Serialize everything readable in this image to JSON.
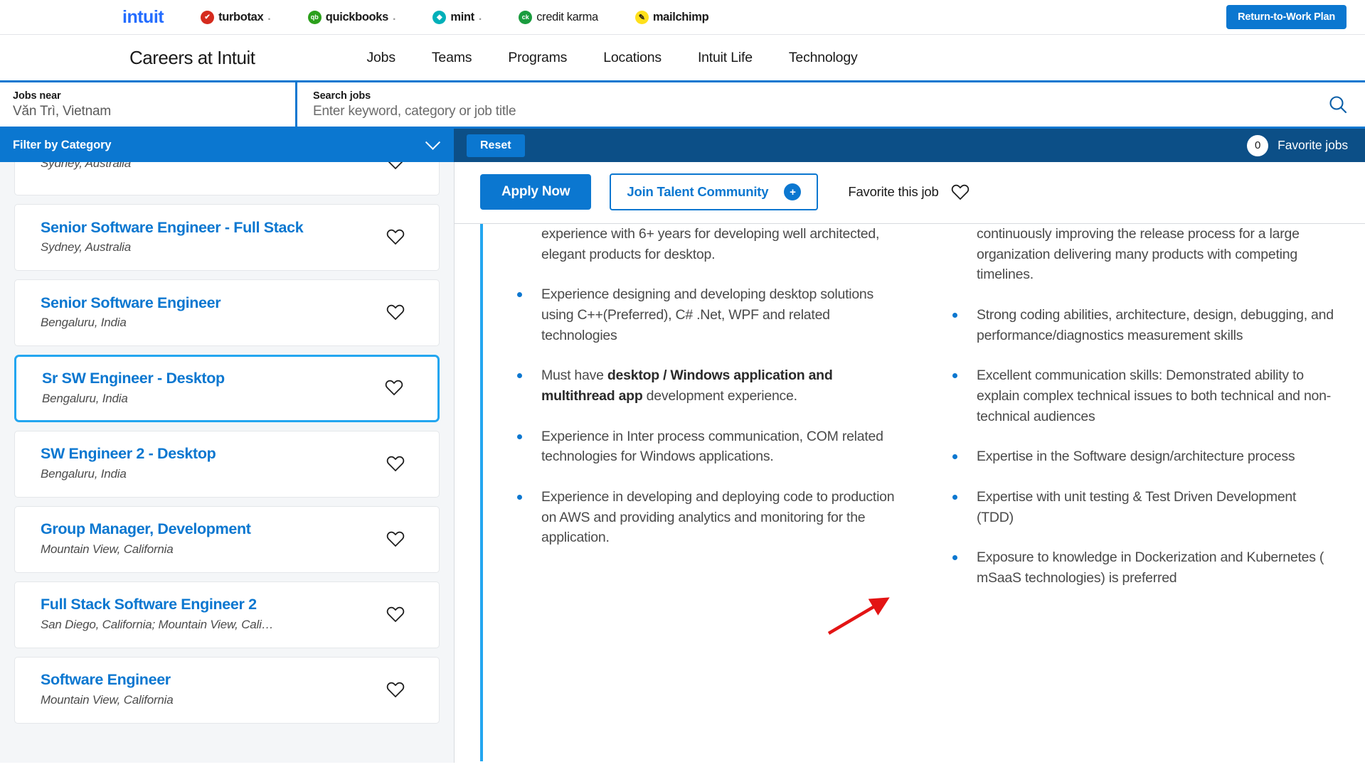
{
  "brandbar": {
    "logos": [
      {
        "name": "intuit",
        "label": "intuit",
        "type": "wordmark"
      },
      {
        "name": "turbotax",
        "label": "turbotax",
        "mark": "✔",
        "color": "#d52b1e"
      },
      {
        "name": "quickbooks",
        "label": "quickbooks",
        "mark": "qb",
        "color": "#2ca01c"
      },
      {
        "name": "mint",
        "label": "mint",
        "mark": "◆",
        "color": "#00b0b9"
      },
      {
        "name": "credit karma",
        "label": "credit karma",
        "mark": "ck",
        "color": "#1a9c3e"
      },
      {
        "name": "mailchimp",
        "label": "mailchimp",
        "mark": "✎",
        "color": "#ffe01b"
      }
    ],
    "cta_label": "Return-to-Work Plan"
  },
  "mainnav": {
    "site_title": "Careers at Intuit",
    "links": [
      {
        "label": "Jobs"
      },
      {
        "label": "Teams"
      },
      {
        "label": "Programs"
      },
      {
        "label": "Locations"
      },
      {
        "label": "Intuit Life"
      },
      {
        "label": "Technology"
      }
    ]
  },
  "search": {
    "location_label": "Jobs near",
    "location_value": "Văn Trì, Vietnam",
    "keyword_label": "Search jobs",
    "keyword_value": "",
    "keyword_placeholder": "Enter keyword, category or job title",
    "search_icon": "search-icon"
  },
  "toolbar": {
    "filter_label": "Filter by Category",
    "reset_label": "Reset",
    "favorite_count": "0",
    "favorite_label": "Favorite jobs"
  },
  "joblist": [
    {
      "title": "",
      "location": "Sydney, Australia",
      "selected": false,
      "partial": true
    },
    {
      "title": "Senior Software Engineer - Full Stack",
      "location": "Sydney, Australia",
      "selected": false
    },
    {
      "title": "Senior Software Engineer",
      "location": "Bengaluru, India",
      "selected": false
    },
    {
      "title": "Sr SW Engineer - Desktop",
      "location": "Bengaluru, India",
      "selected": true
    },
    {
      "title": "SW Engineer 2 - Desktop",
      "location": "Bengaluru, India",
      "selected": false
    },
    {
      "title": "Group Manager, Development",
      "location": "Mountain View, California",
      "selected": false
    },
    {
      "title": "Full Stack Software Engineer 2",
      "location": "San Diego, California; Mountain View, Cali…",
      "selected": false
    },
    {
      "title": "Software Engineer",
      "location": "Mountain View, California",
      "selected": false
    }
  ],
  "detail": {
    "apply_label": "Apply Now",
    "join_label": "Join Talent Community",
    "join_icon": "plus-icon",
    "favorite_label": "Favorite this job",
    "favorite_icon": "heart-icon",
    "left_column": {
      "continuation": "experience with 6+ years for developing well architected, elegant products for desktop.",
      "bullets": [
        {
          "html": "Experience designing and developing desktop solutions using C++(Preferred), C# .Net, WPF and related technologies"
        },
        {
          "html": "Must have <b>desktop / Windows application and multithread app</b> development experience."
        },
        {
          "html": "Experience in Inter process communication, COM related technologies for Windows applications."
        },
        {
          "html": "Experience in developing and deploying code to production on AWS and providing analytics and monitoring for the application."
        }
      ]
    },
    "right_column": {
      "continuation": "continuously improving the release process for a large organization delivering many products with competing timelines.",
      "bullets": [
        {
          "html": "Strong coding abilities, architecture, design, debugging, and performance/diagnostics measurement skills"
        },
        {
          "html": "Excellent communication skills: Demonstrated ability to explain complex technical issues to both technical and non-technical audiences"
        },
        {
          "html": "Expertise in the Software design/architecture process"
        },
        {
          "html": "Expertise with unit testing &amp; Test Driven Development (TDD)"
        },
        {
          "html": "Exposure to knowledge in Dockerization and Kubernetes ( mSaaS technologies) is preferred"
        }
      ]
    }
  },
  "annotation": {
    "type": "red-arrow",
    "color": "#e31414"
  },
  "colors": {
    "brand_blue": "#0b77d0",
    "dark_blue": "#0c4f87",
    "highlight_blue": "#23a6f0",
    "intuit_blue": "#236cff"
  }
}
